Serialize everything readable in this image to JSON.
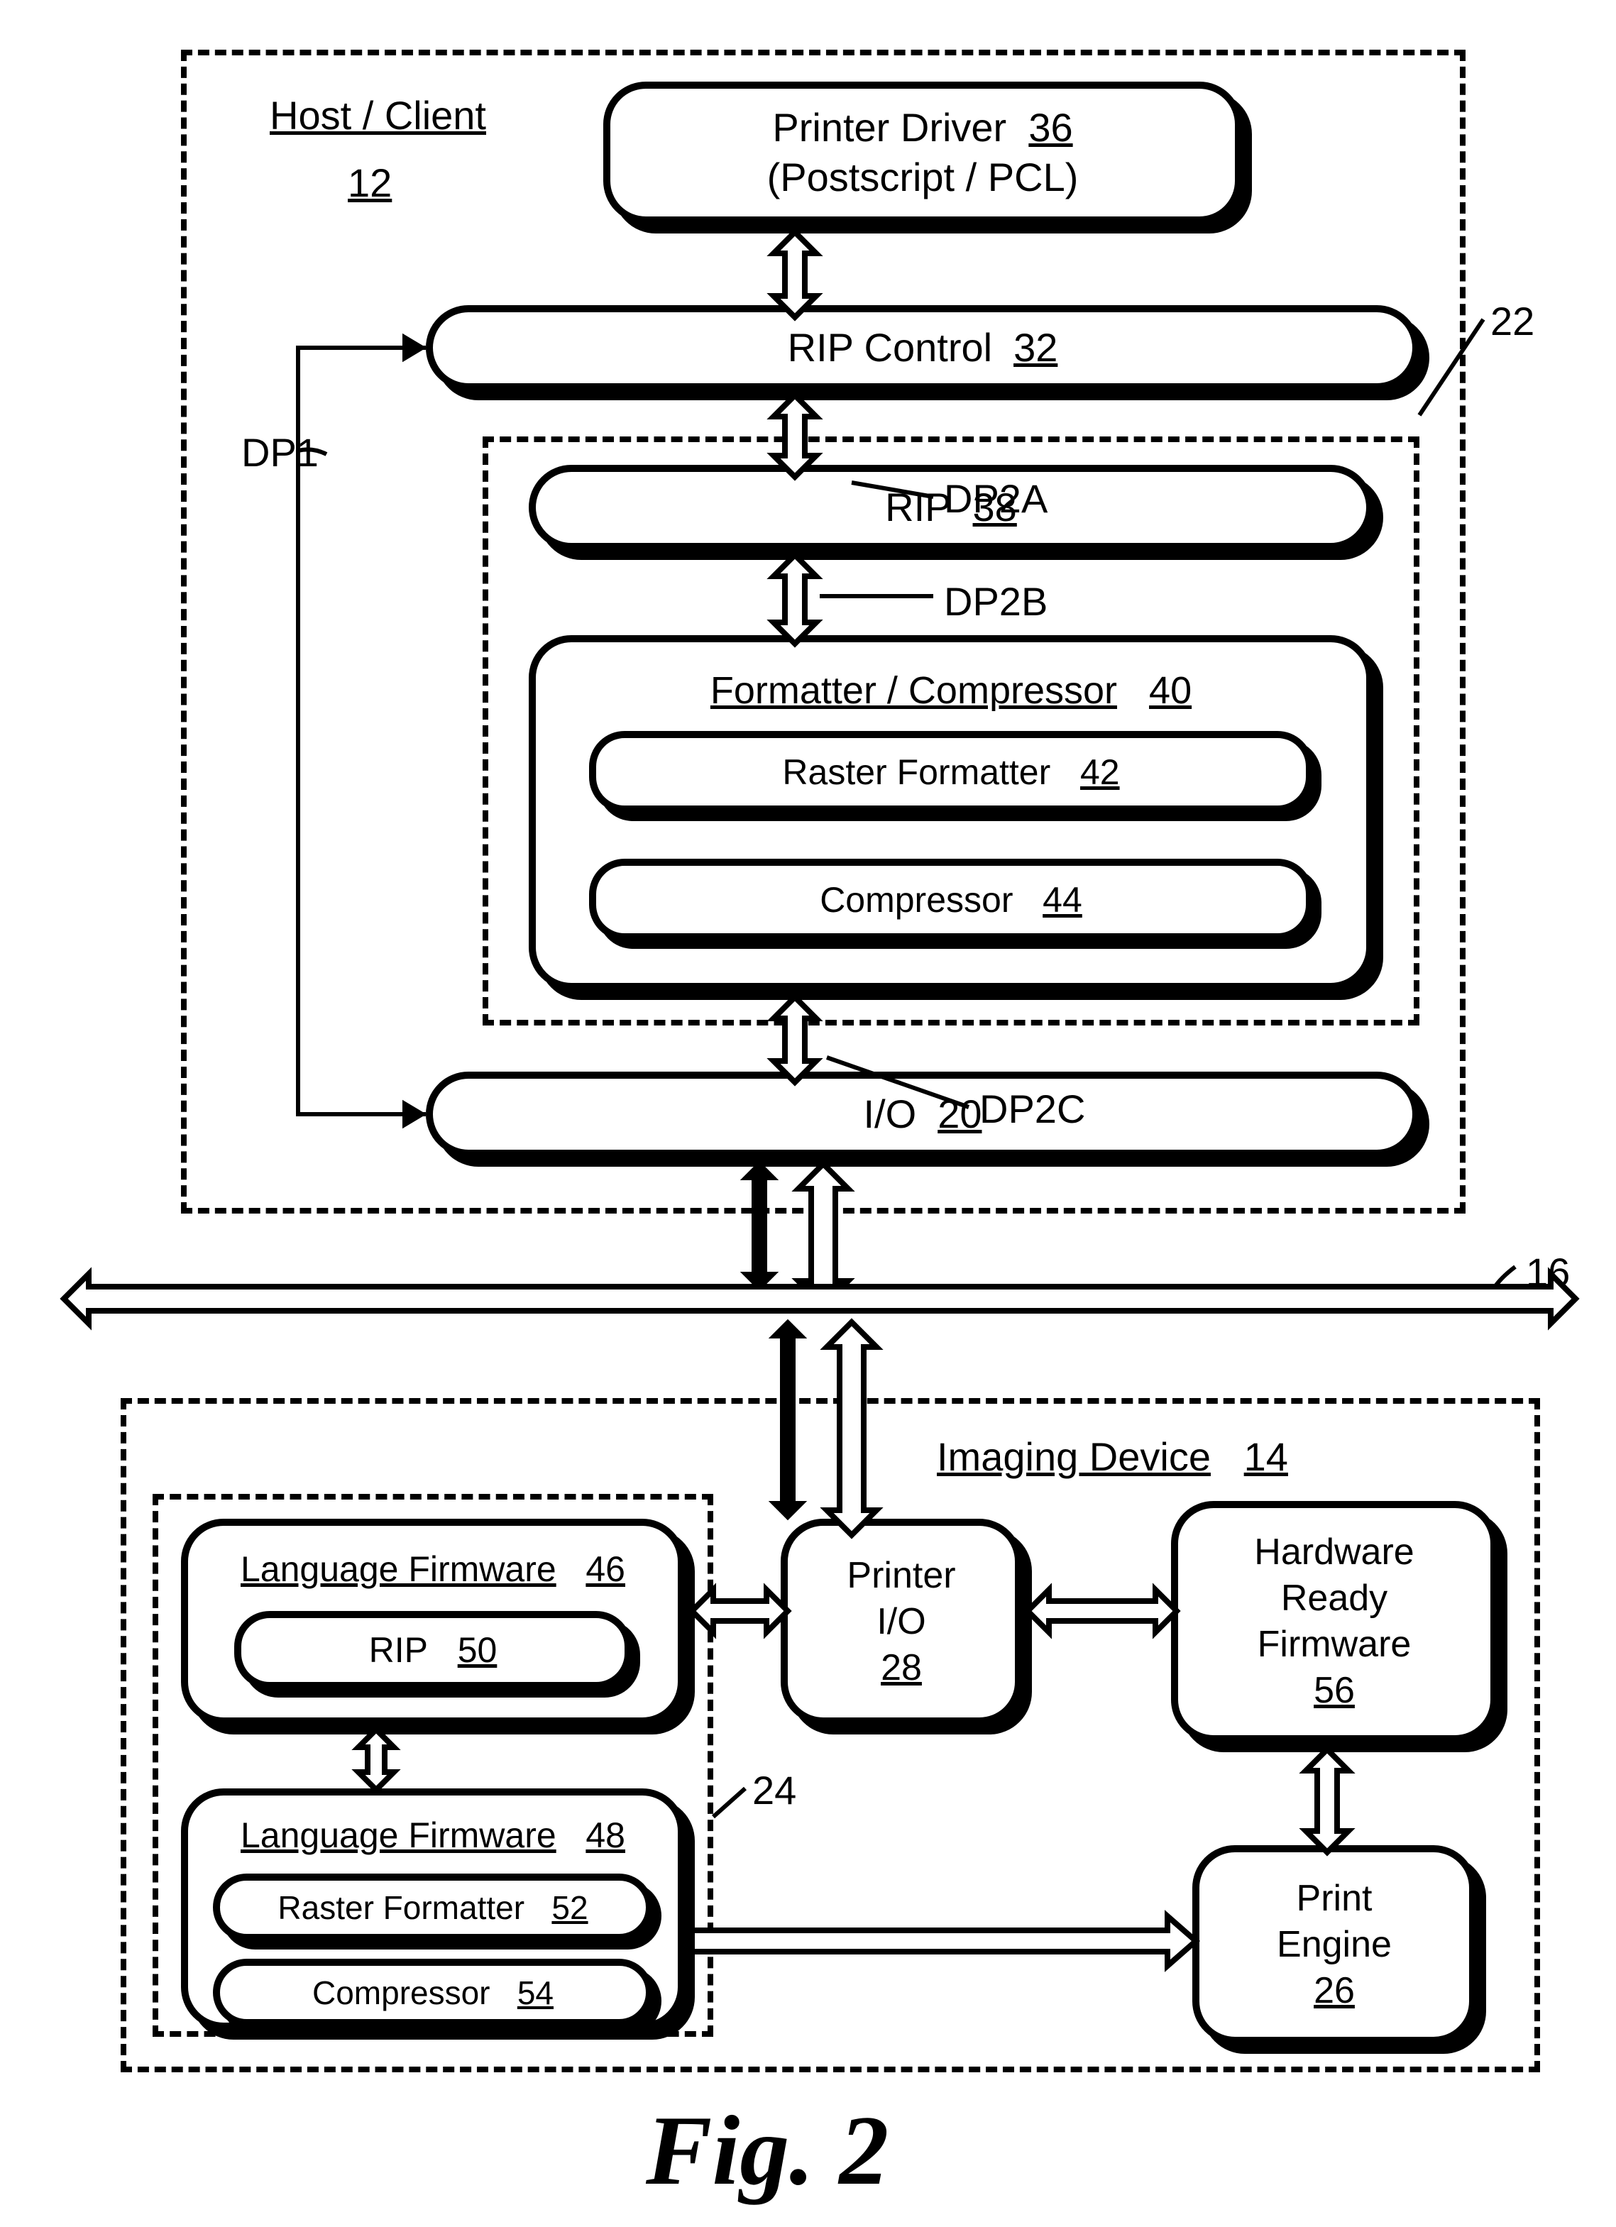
{
  "figure": "Fig. 2",
  "host": {
    "title": "Host / Client",
    "ref": "12"
  },
  "printerDriver": {
    "line1": "Printer Driver",
    "ref": "36",
    "line2": "(Postscript / PCL)"
  },
  "ripControl": {
    "label": "RIP Control",
    "ref": "32"
  },
  "rip": {
    "label": "RIP",
    "ref": "38"
  },
  "formatter": {
    "title": "Formatter / Compressor",
    "ref": "40"
  },
  "rasterFormatter": {
    "label": "Raster Formatter",
    "ref": "42"
  },
  "compressor": {
    "label": "Compressor",
    "ref": "44"
  },
  "io": {
    "label": "I/O",
    "ref": "20"
  },
  "imagingDevice": {
    "title": "Imaging Device",
    "ref": "14"
  },
  "langFw1": {
    "title": "Language Firmware",
    "ref": "46",
    "rip": "RIP",
    "ripRef": "50"
  },
  "langFw2": {
    "title": "Language Firmware",
    "ref": "48",
    "rf": "Raster Formatter",
    "rfRef": "52",
    "comp": "Compressor",
    "compRef": "54"
  },
  "printerIO": {
    "label": "Printer\nI/O",
    "ref": "28"
  },
  "hrf": {
    "line1": "Hardware",
    "line2": "Ready",
    "line3": "Firmware",
    "ref": "56"
  },
  "printEngine": {
    "line1": "Print",
    "line2": "Engine",
    "ref": "26"
  },
  "dp1": "DP1",
  "dp2a": "DP2A",
  "dp2b": "DP2B",
  "dp2c": "DP2C",
  "groupHost": "22",
  "groupDevice": "24",
  "bus": "16"
}
